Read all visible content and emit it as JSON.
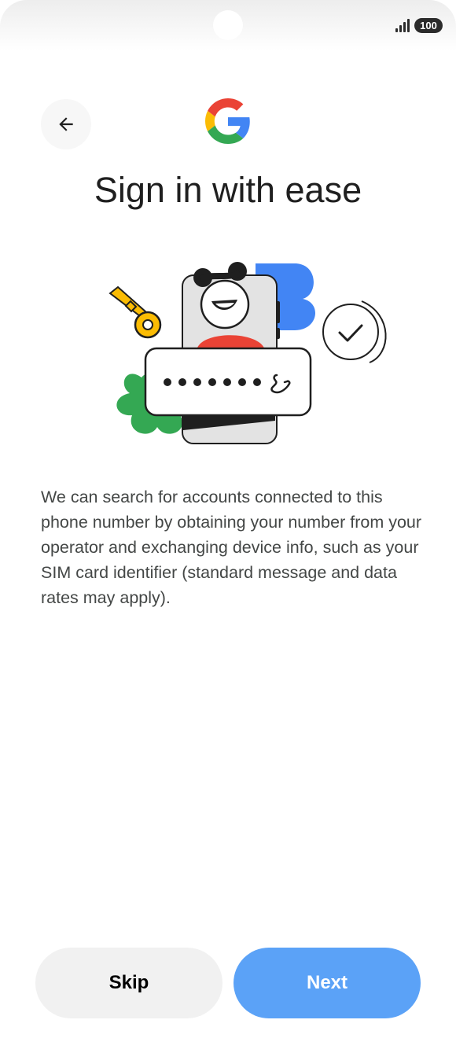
{
  "status_bar": {
    "battery_level": "100",
    "signal_icon": "cellular-signal-icon"
  },
  "header": {
    "back_icon": "arrow-left-icon",
    "logo": "google-g-logo"
  },
  "title": "Sign in with ease",
  "illustration": {
    "password_mask": "•••••••",
    "phone_icon": "phone-handset-icon",
    "check_icon": "checkmark-icon",
    "key_icon": "key-icon"
  },
  "description": "We can search for accounts connected to this phone number by obtaining your number from your operator and exchanging device info, such as your SIM card identifier (standard message and data rates may apply).",
  "buttons": {
    "skip_label": "Skip",
    "next_label": "Next"
  },
  "colors": {
    "next_button": "#5ba2f7",
    "skip_button": "#f1f1f1",
    "google_blue": "#4285f4",
    "google_red": "#ea4335",
    "google_yellow": "#fbbc04",
    "google_green": "#34a853"
  }
}
